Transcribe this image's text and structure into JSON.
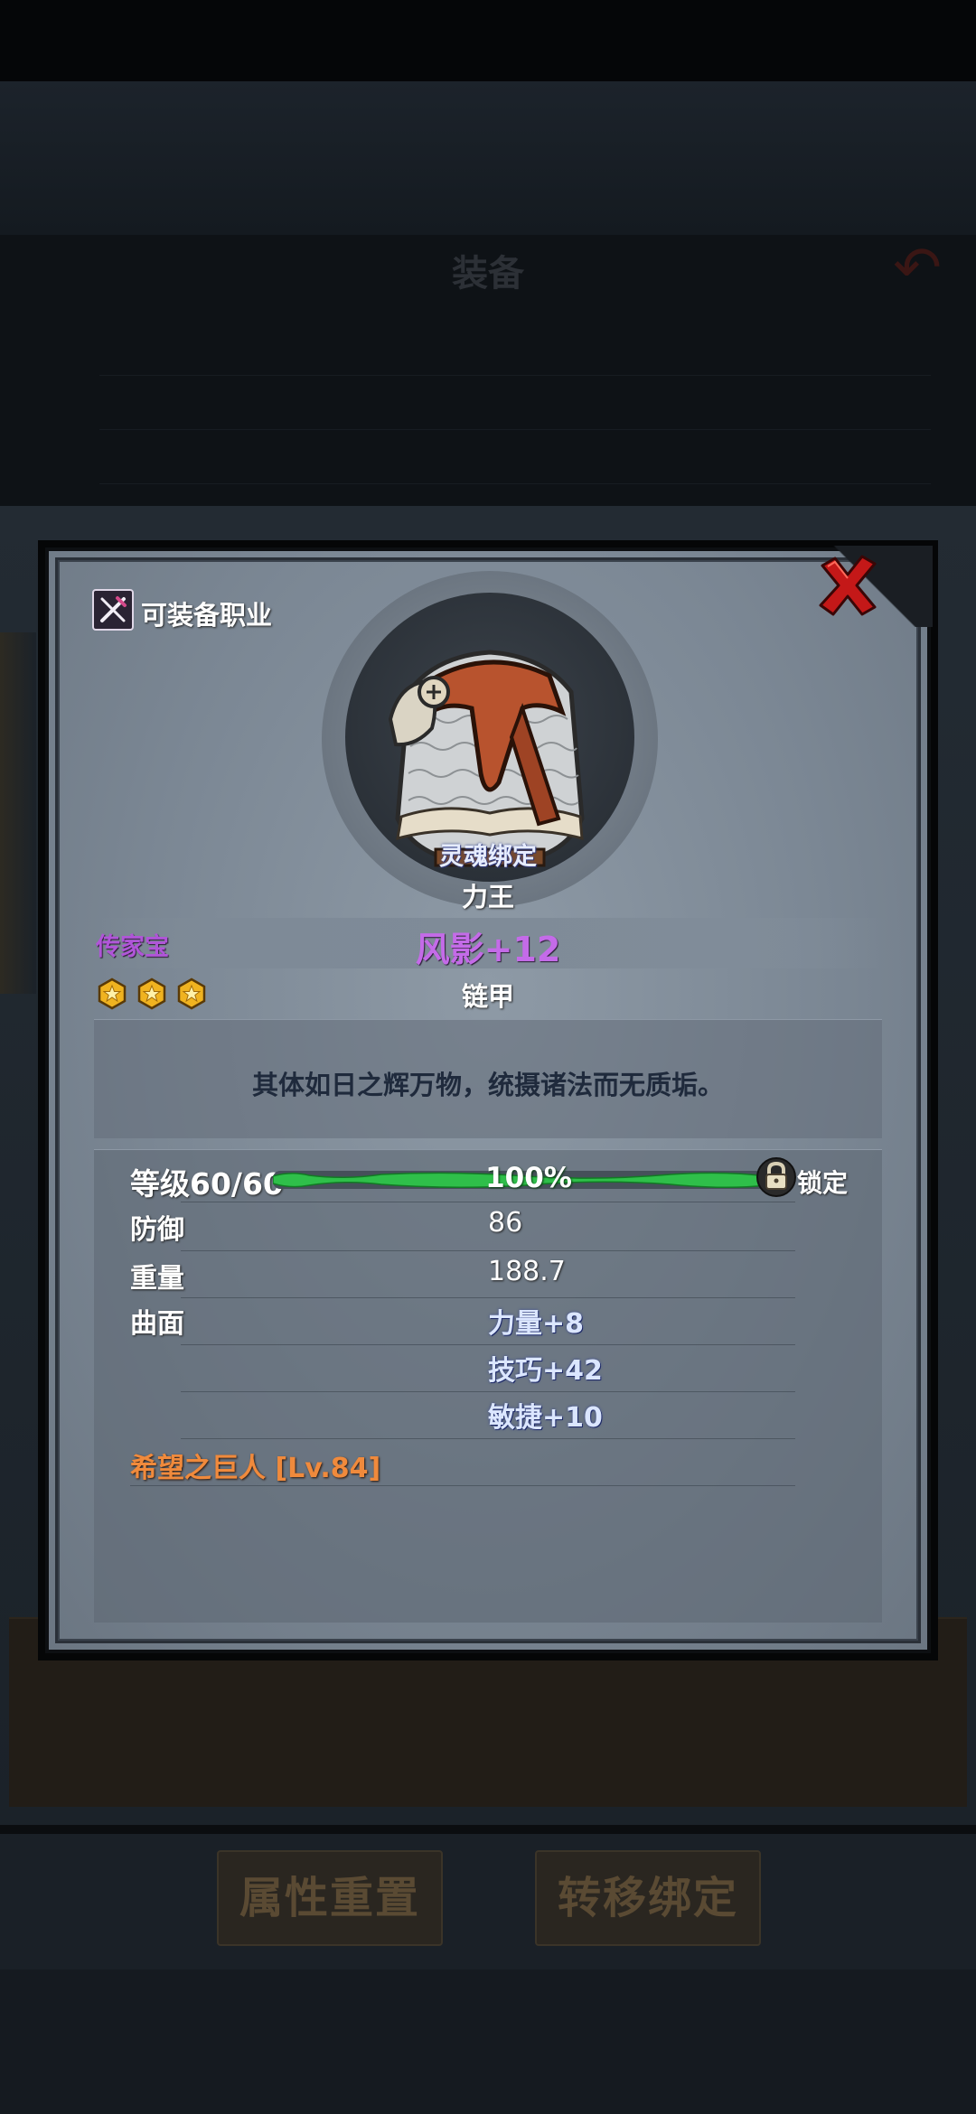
{
  "background": {
    "header_title": "装备",
    "buttons": [
      {
        "label": "属性重置"
      },
      {
        "label": "转移绑定"
      }
    ]
  },
  "modal": {
    "job_label": "可装备职业",
    "soulbind_label": "灵魂绑定",
    "class_name": "力王",
    "rarity": "传家宝",
    "rarity_color": "#b055d8",
    "item_name": "风影+12",
    "item_name_color": "#c46be8",
    "star_count": 3,
    "item_type": "链甲",
    "description": "其体如日之辉万物，统摄诸法而无质垢。",
    "level": {
      "label": "等级60/60",
      "progress_percent": 100,
      "progress_text": "100%",
      "bar_color": "#2fbf4a",
      "lock_label": "锁定"
    },
    "stats": [
      {
        "label": "防御",
        "value": "86"
      },
      {
        "label": "重量",
        "value": "188.7"
      },
      {
        "label": "曲面",
        "value": "力量+8"
      },
      {
        "label": "",
        "value": "技巧+42"
      },
      {
        "label": "",
        "value": "敏捷+10"
      }
    ],
    "set_name": "希望之巨人 [Lv.84]",
    "set_color": "#f08a3c",
    "icons": {
      "close": "close-x-icon",
      "job": "crossed-tools-icon",
      "star": "hex-star-icon",
      "lock": "padlock-icon"
    }
  }
}
